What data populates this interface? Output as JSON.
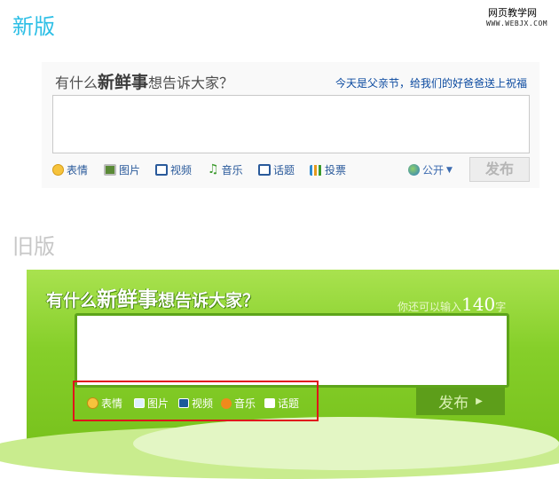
{
  "watermark": {
    "title": "网页教学网",
    "url": "WWW.WEBJX.COM"
  },
  "sections": {
    "new_label": "新版",
    "old_label": "旧版"
  },
  "new_composer": {
    "prompt": {
      "p1": "有什么",
      "em": "新鲜事",
      "p2": "想告诉大家？"
    },
    "hint": "今天是父亲节，给我们的好爸爸送上祝福",
    "tools": [
      {
        "icon": "smile-icon",
        "label": "表情"
      },
      {
        "icon": "picture-icon",
        "label": "图片"
      },
      {
        "icon": "video-icon",
        "label": "视频"
      },
      {
        "icon": "music-icon",
        "label": "音乐"
      },
      {
        "icon": "topic-icon",
        "label": "话题"
      },
      {
        "icon": "vote-icon",
        "label": "投票"
      }
    ],
    "visibility": "公开",
    "send_label": "发布"
  },
  "old_composer": {
    "prompt": {
      "p1": "有什么",
      "em": "新鲜事",
      "p2": "想告诉大家？"
    },
    "count_prefix": "你还可以输入",
    "count_number": "140",
    "count_suffix": "字",
    "tools": [
      {
        "icon": "smile-icon",
        "label": "表情"
      },
      {
        "icon": "picture-icon",
        "label": "图片"
      },
      {
        "icon": "video-icon",
        "label": "视频"
      },
      {
        "icon": "music-icon",
        "label": "音乐"
      },
      {
        "icon": "topic-icon",
        "label": "话题"
      }
    ],
    "send_label": "发布"
  },
  "colors": {
    "new_accent": "#2dbfe6",
    "old_green": "#86cf2a",
    "highlight_red": "#e0141b"
  }
}
